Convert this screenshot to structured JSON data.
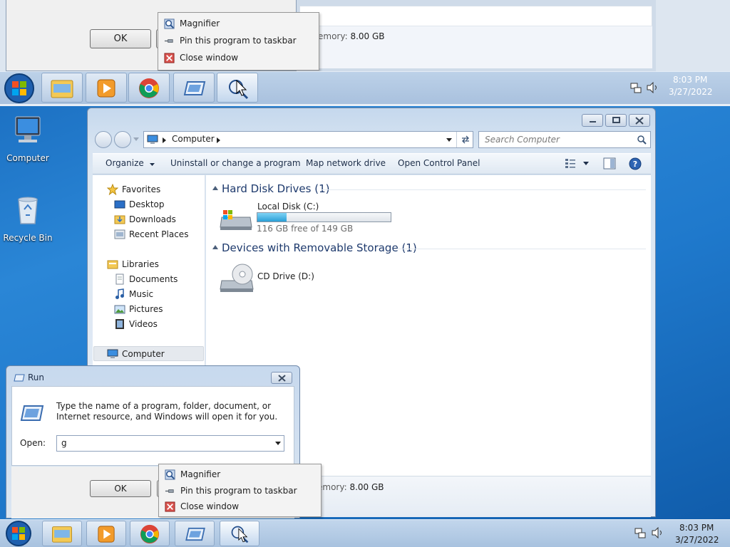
{
  "magnifier": {
    "dialog_ok": "OK",
    "memory_label": "emory:",
    "memory_value": "8.00 GB",
    "menu": {
      "magnifier": "Magnifier",
      "pin": "Pin this program to taskbar",
      "close": "Close window"
    },
    "clock": {
      "time": "8:03 PM",
      "date": "3/27/2022"
    }
  },
  "desktop": {
    "icons": [
      {
        "label": "Computer"
      },
      {
        "label": "Recycle Bin"
      }
    ]
  },
  "explorer": {
    "address": "Computer",
    "search_placeholder": "Search Computer",
    "toolbar": {
      "organize": "Organize",
      "uninstall": "Uninstall or change a program",
      "map_drive": "Map network drive",
      "control_panel": "Open Control Panel"
    },
    "nav": {
      "favorites": "Favorites",
      "desktop": "Desktop",
      "downloads": "Downloads",
      "recent": "Recent Places",
      "libraries": "Libraries",
      "documents": "Documents",
      "music": "Music",
      "pictures": "Pictures",
      "videos": "Videos",
      "computer": "Computer"
    },
    "groups": {
      "hdd_title": "Hard Disk Drives (1)",
      "removable_title": "Devices with Removable Storage (1)"
    },
    "local_disk": {
      "name": "Local Disk (C:)",
      "free_text": "116 GB free of 149 GB",
      "used_fraction": 0.22
    },
    "cd_drive": {
      "name": "CD Drive (D:)"
    },
    "details": {
      "memory_label": "emory:",
      "memory_value": "8.00 GB"
    }
  },
  "run": {
    "title": "Run",
    "description": "Type the name of a program, folder, document, or Internet resource, and Windows will open it for you.",
    "open_label": "Open:",
    "open_value": "g",
    "ok_label": "OK"
  },
  "menu": {
    "magnifier": "Magnifier",
    "pin": "Pin this program to taskbar",
    "close": "Close window"
  },
  "taskbar": {
    "clock": {
      "time": "8:03 PM",
      "date": "3/27/2022"
    }
  },
  "colors": {
    "accent": "#3a8fd0",
    "progress_fill": "#2a9fd6"
  }
}
